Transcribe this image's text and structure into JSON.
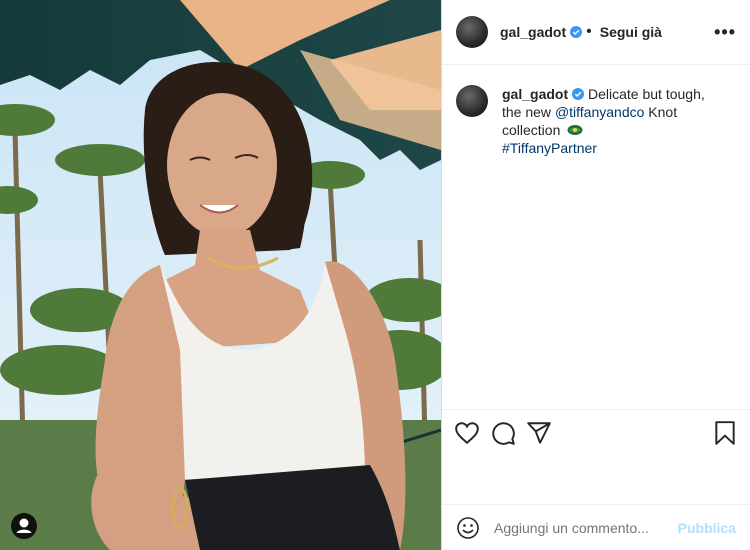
{
  "header": {
    "username": "gal_gadot",
    "separator": "•",
    "follow_status": "Segui già",
    "more_label": "•••"
  },
  "caption": {
    "username": "gal_gadot",
    "text_1": "Delicate but tough, the new ",
    "mention": "@tiffanyandco",
    "text_2": " Knot collection",
    "hashtag": "#TiffanyPartner"
  },
  "comment": {
    "placeholder": "Aggiungi un commento...",
    "publish_label": "Pubblica"
  },
  "colors": {
    "verified_blue": "#3897f0",
    "link_blue": "#00376b",
    "publish_disabled": "#b2dffc"
  },
  "icons": [
    "heart-icon",
    "comment-icon",
    "share-icon",
    "bookmark-icon",
    "smiley-icon",
    "verified-icon",
    "user-tag-icon"
  ]
}
